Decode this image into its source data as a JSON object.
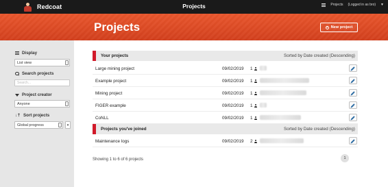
{
  "nav": {
    "brand": "Redcoat",
    "title": "Projects",
    "projects_link": "Projects",
    "logged_in": "(Logged in as bro)"
  },
  "header": {
    "heading": "Projects",
    "new_project_label": "New project"
  },
  "sidebar": {
    "display": {
      "label": "Display",
      "value": "List view"
    },
    "search": {
      "label": "Search projects",
      "placeholder": "Search..."
    },
    "creator": {
      "label": "Project creator",
      "value": "Anyone"
    },
    "sort": {
      "label": "Sort projects",
      "value": "Global progress"
    }
  },
  "your_projects": {
    "title": "Your projects",
    "sorted": "Sorted by Date created (Descending)",
    "rows": [
      {
        "name": "Large mining project",
        "date": "09/02/2019",
        "count": "1"
      },
      {
        "name": "Example project",
        "date": "09/02/2019",
        "count": "1"
      },
      {
        "name": "Mining project",
        "date": "09/02/2019",
        "count": "1"
      },
      {
        "name": "FIGER example",
        "date": "09/02/2019",
        "count": "1"
      },
      {
        "name": "CoNLL",
        "date": "09/02/2019",
        "count": "1"
      }
    ]
  },
  "joined_projects": {
    "title": "Projects you've joined",
    "sorted": "Sorted by Date created (Descending)",
    "rows": [
      {
        "name": "Maintenance logs",
        "date": "09/02/2019",
        "count": "2"
      }
    ]
  },
  "footer": {
    "showing": "Showing 1 to 6 of 6 projects",
    "page": "1"
  }
}
